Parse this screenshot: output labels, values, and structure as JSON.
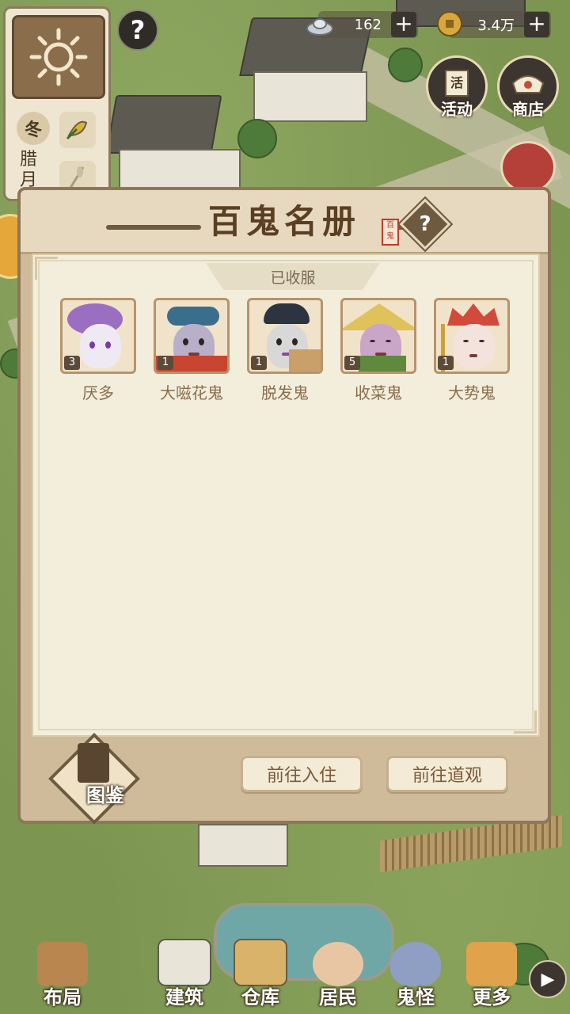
{
  "hud": {
    "season": "冬",
    "month": "腊月",
    "help": "?",
    "silver_value": "162",
    "coin_value": "3.4万",
    "plus": "+",
    "activity_label": "活动",
    "activity_badge": "活",
    "shop_label": "商店"
  },
  "modal": {
    "title": "百鬼名册",
    "seal_text": "百鬼",
    "help": "?",
    "tab_label": "已收服",
    "ghosts": [
      {
        "name": "厌多",
        "count": "3"
      },
      {
        "name": "大嗞花鬼",
        "count": "1"
      },
      {
        "name": "脱发鬼",
        "count": "1"
      },
      {
        "name": "收菜鬼",
        "count": "5"
      },
      {
        "name": "大势鬼",
        "count": "1"
      }
    ],
    "atlas_label": "图鉴",
    "btn_move_in": "前往入住",
    "btn_temple": "前往道观"
  },
  "nav": {
    "layout": "布局",
    "build": "建筑",
    "storage": "仓库",
    "residents": "居民",
    "ghosts": "鬼怪",
    "more": "更多",
    "arrow": "▶"
  },
  "colors": {
    "panel_bg": "#cfbb9a",
    "paper_bg": "#f3eedb",
    "title_brown": "#5a3f22",
    "name_brown": "#8a6d4f",
    "grass": "#7c9652"
  }
}
